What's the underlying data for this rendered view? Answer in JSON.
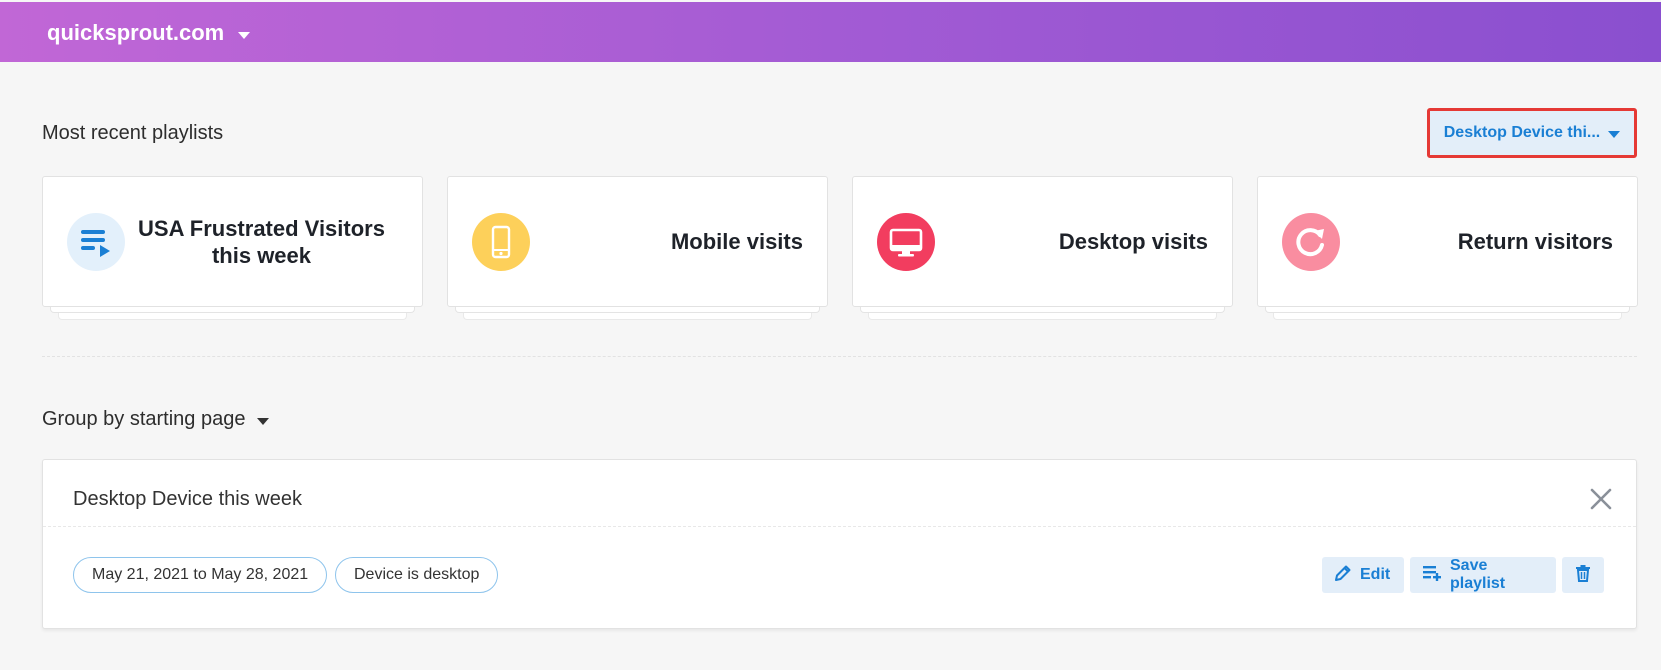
{
  "header": {
    "site_name": "quicksprout.com"
  },
  "recent": {
    "title": "Most recent playlists",
    "filter_label": "Desktop Device thi..."
  },
  "cards": [
    {
      "label": "USA Frustrated Visitors this week",
      "icon": "playlist-icon",
      "color": "#e3f0fb"
    },
    {
      "label": "Mobile visits",
      "icon": "mobile-phone-icon",
      "color": "#fdd05a"
    },
    {
      "label": "Desktop visits",
      "icon": "desktop-monitor-icon",
      "color": "#f23d5f"
    },
    {
      "label": "Return visitors",
      "icon": "refresh-icon",
      "color": "#f98da0"
    }
  ],
  "group_by": {
    "label": "Group by starting page"
  },
  "playlist_panel": {
    "title": "Desktop Device this week",
    "filters": [
      "May 21, 2021 to May 28, 2021",
      "Device is desktop"
    ],
    "edit_label": "Edit",
    "save_label": "Save playlist"
  },
  "colors": {
    "accent": "#1a7fd4",
    "header_start": "#c167d6",
    "header_end": "#8a4fcf",
    "highlight_border": "#e53935"
  }
}
